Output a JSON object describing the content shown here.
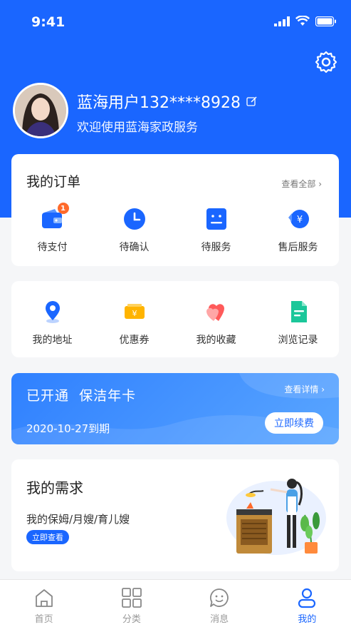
{
  "status": {
    "time": "9:41"
  },
  "profile": {
    "username": "蓝海用户132****8928",
    "welcome": "欢迎使用蓝海家政服务"
  },
  "orders": {
    "title": "我的订单",
    "view_all": "查看全部",
    "items": [
      {
        "label": "待支付",
        "icon": "wallet-icon",
        "badge": "1"
      },
      {
        "label": "待确认",
        "icon": "clock-icon"
      },
      {
        "label": "待服务",
        "icon": "service-icon"
      },
      {
        "label": "售后服务",
        "icon": "refund-icon"
      }
    ]
  },
  "tools": {
    "items": [
      {
        "label": "我的地址",
        "icon": "location-icon"
      },
      {
        "label": "优惠券",
        "icon": "coupon-icon"
      },
      {
        "label": "我的收藏",
        "icon": "favorites-icon"
      },
      {
        "label": "浏览记录",
        "icon": "history-icon"
      }
    ]
  },
  "vip": {
    "title": "已开通  保洁年卡",
    "detail": "查看详情",
    "expire": "2020-10-27到期",
    "renew": "立即续费"
  },
  "need": {
    "title": "我的需求",
    "subtitle": "我的保姆/月嫂/育儿嫂",
    "button": "立即查看"
  },
  "tabbar": {
    "items": [
      {
        "label": "首页",
        "icon": "home-icon"
      },
      {
        "label": "分类",
        "icon": "category-icon"
      },
      {
        "label": "消息",
        "icon": "message-icon"
      },
      {
        "label": "我的",
        "icon": "profile-icon",
        "active": true
      }
    ]
  },
  "colors": {
    "primary": "#1a66ff",
    "badge": "#ff6a2b"
  }
}
